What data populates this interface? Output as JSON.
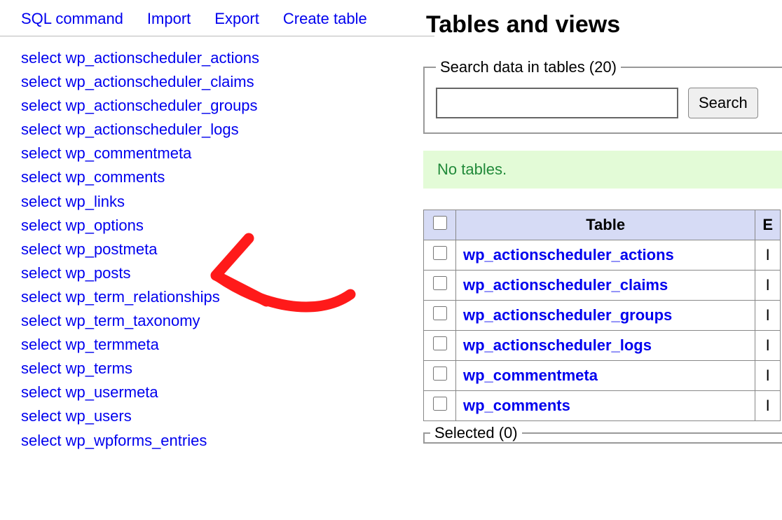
{
  "sidebar": {
    "top_links": [
      {
        "label": "SQL command"
      },
      {
        "label": "Import"
      },
      {
        "label": "Export"
      },
      {
        "label": "Create table"
      }
    ],
    "table_prefix": "select",
    "tables": [
      "wp_actionscheduler_actions",
      "wp_actionscheduler_claims",
      "wp_actionscheduler_groups",
      "wp_actionscheduler_logs",
      "wp_commentmeta",
      "wp_comments",
      "wp_links",
      "wp_options",
      "wp_postmeta",
      "wp_posts",
      "wp_term_relationships",
      "wp_term_taxonomy",
      "wp_termmeta",
      "wp_terms",
      "wp_usermeta",
      "wp_users",
      "wp_wpforms_entries"
    ]
  },
  "main": {
    "heading": "Tables and views",
    "search_legend": "Search data in tables (20)",
    "search_button": "Search",
    "no_tables_text": "No tables.",
    "columns": {
      "table_header": "Table",
      "engine_hint": "E"
    },
    "engine_cell": "I",
    "rows": [
      {
        "name": "wp_actionscheduler_actions"
      },
      {
        "name": "wp_actionscheduler_claims"
      },
      {
        "name": "wp_actionscheduler_groups"
      },
      {
        "name": "wp_actionscheduler_logs"
      },
      {
        "name": "wp_commentmeta"
      },
      {
        "name": "wp_comments"
      }
    ],
    "selected_legend": "Selected (0)"
  }
}
